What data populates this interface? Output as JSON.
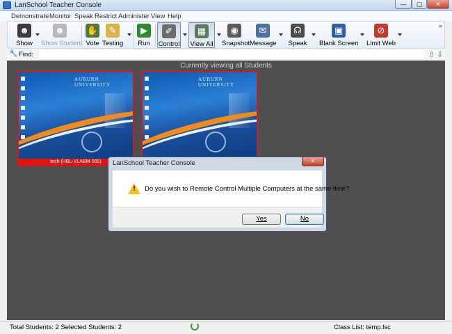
{
  "window": {
    "title": "LanSchool Teacher Console",
    "min": "—",
    "max": "▢",
    "close": "✕"
  },
  "menu": [
    "Demonstrate",
    "Monitor",
    "Speak",
    "Restrict",
    "Administer",
    "View",
    "Help"
  ],
  "toolbar": {
    "show": "Show",
    "show_student": "Show Student",
    "vote": "Vote",
    "testing": "Testing",
    "run": "Run",
    "control": "Control",
    "view_all": "View All",
    "snapshot": "Snapshot",
    "message": "Message",
    "speak": "Speak",
    "blank_screen": "Blank Screen",
    "limit_web": "Limit Web",
    "more": "»"
  },
  "find": {
    "label": "Find:",
    "value": ""
  },
  "main": {
    "viewing_text": "Currently viewing all Students",
    "thumbnails": [
      {
        "caption": "tech (HBL-VLABM-005)",
        "logo": "AUBURN UNIVERSITY"
      },
      {
        "caption": "",
        "logo": "AUBURN UNIVERSITY"
      }
    ]
  },
  "dialog": {
    "title": "LanSchool Teacher Console",
    "close": "✕",
    "message": "Do you wish to Remote Control Multiple Computers at the same time?",
    "warning_mark": "!",
    "yes_label": "Yes",
    "no_label": "No"
  },
  "status": {
    "left": "Total Students: 2  Selected Students: 2",
    "right": "Class List: temp.lsc"
  },
  "colors": {
    "selection_border": "#d11c1c",
    "caption_bg": "#e01313",
    "main_bg": "#4f4f4f"
  },
  "icons": [
    "show-icon",
    "show-student-icon",
    "vote-icon",
    "testing-icon",
    "run-icon",
    "control-icon",
    "view-all-icon",
    "snapshot-icon",
    "message-icon",
    "speak-icon",
    "blank-screen-icon",
    "limit-web-icon",
    "find-icon",
    "arrow-up-icon",
    "arrow-down-icon",
    "warning-icon",
    "refresh-icon"
  ]
}
